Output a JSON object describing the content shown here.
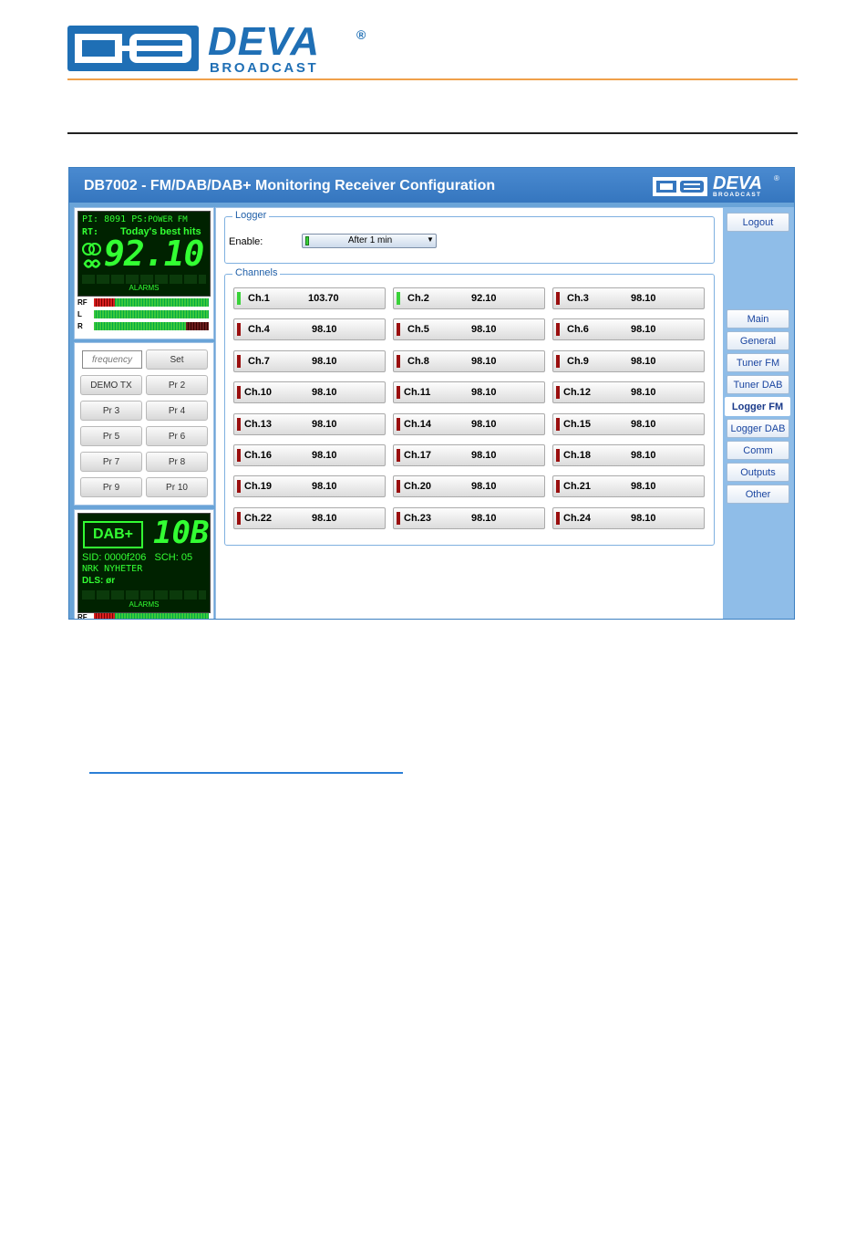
{
  "header": {
    "brand": "DEVA",
    "brand_sub": "BROADCAST",
    "registered": "®",
    "accent_color": "#1f6fb5",
    "rule_color": "#f0a04a"
  },
  "app": {
    "title": "DB7002 - FM/DAB/DAB+ Monitoring Receiver Configuration",
    "brand": "DEVA",
    "brand_sub": "BROADCAST",
    "registered": "®"
  },
  "fm_display": {
    "pi_label": "PI: 8091",
    "ps_label": "PS:",
    "ps_value": "POWER  FM",
    "rt_label": "RT:",
    "rt_value": "Today's best hits",
    "frequency": "92.10",
    "alarms": "ALARMS",
    "meters": [
      {
        "label": "RF",
        "red_fraction": 0.18,
        "dark_fraction": 0
      },
      {
        "label": "L",
        "red_fraction": 0,
        "dark_fraction": 0
      },
      {
        "label": "R",
        "red_fraction": 0,
        "dark_fraction": 0.2
      }
    ]
  },
  "presets": {
    "frequency_placeholder": "frequency",
    "set_label": "Set",
    "buttons": [
      "DEMO TX",
      "Pr 2",
      "Pr 3",
      "Pr 4",
      "Pr 5",
      "Pr 6",
      "Pr 7",
      "Pr 8",
      "Pr 9",
      "Pr 10"
    ]
  },
  "dab_display": {
    "badge": "DAB+",
    "channel": "10B",
    "sid": "SID: 0000f206",
    "sch": "SCH: 05",
    "service": "NRK  NYHETER",
    "dls_label": "DLS:",
    "dls_value": "ør",
    "alarms": "ALARMS",
    "rf_label": "RF"
  },
  "logger": {
    "legend": "Logger",
    "enable_label": "Enable:",
    "enable_value": "After 1 min"
  },
  "channels": {
    "legend": "Channels",
    "items": [
      {
        "name": "Ch.1",
        "value": "103.70",
        "status": "green"
      },
      {
        "name": "Ch.2",
        "value": "92.10",
        "status": "green"
      },
      {
        "name": "Ch.3",
        "value": "98.10",
        "status": "red"
      },
      {
        "name": "Ch.4",
        "value": "98.10",
        "status": "red"
      },
      {
        "name": "Ch.5",
        "value": "98.10",
        "status": "red"
      },
      {
        "name": "Ch.6",
        "value": "98.10",
        "status": "red"
      },
      {
        "name": "Ch.7",
        "value": "98.10",
        "status": "red"
      },
      {
        "name": "Ch.8",
        "value": "98.10",
        "status": "red"
      },
      {
        "name": "Ch.9",
        "value": "98.10",
        "status": "red"
      },
      {
        "name": "Ch.10",
        "value": "98.10",
        "status": "red"
      },
      {
        "name": "Ch.11",
        "value": "98.10",
        "status": "red"
      },
      {
        "name": "Ch.12",
        "value": "98.10",
        "status": "red"
      },
      {
        "name": "Ch.13",
        "value": "98.10",
        "status": "red"
      },
      {
        "name": "Ch.14",
        "value": "98.10",
        "status": "red"
      },
      {
        "name": "Ch.15",
        "value": "98.10",
        "status": "red"
      },
      {
        "name": "Ch.16",
        "value": "98.10",
        "status": "red"
      },
      {
        "name": "Ch.17",
        "value": "98.10",
        "status": "red"
      },
      {
        "name": "Ch.18",
        "value": "98.10",
        "status": "red"
      },
      {
        "name": "Ch.19",
        "value": "98.10",
        "status": "red"
      },
      {
        "name": "Ch.20",
        "value": "98.10",
        "status": "red"
      },
      {
        "name": "Ch.21",
        "value": "98.10",
        "status": "red"
      },
      {
        "name": "Ch.22",
        "value": "98.10",
        "status": "red"
      },
      {
        "name": "Ch.23",
        "value": "98.10",
        "status": "red"
      },
      {
        "name": "Ch.24",
        "value": "98.10",
        "status": "red"
      }
    ]
  },
  "status_colors": {
    "green": "#3ad23a",
    "red": "#9a0f0f"
  },
  "nav": {
    "logout": "Logout",
    "items": [
      "Main",
      "General",
      "Tuner FM",
      "Tuner DAB",
      "Logger FM",
      "Logger DAB",
      "Comm",
      "Outputs",
      "Other"
    ],
    "active": "Logger FM"
  }
}
